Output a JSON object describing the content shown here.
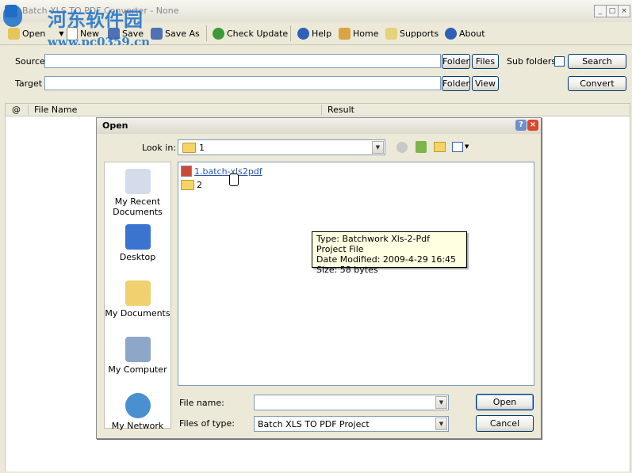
{
  "window": {
    "title": "Batch XLS TO PDF Converter - None",
    "controls": {
      "minimize": "_",
      "maximize": "□",
      "close": "×"
    }
  },
  "watermark": {
    "brand": "河东软件园",
    "url": "www.pc0359.cn"
  },
  "toolbar": {
    "open": "Open",
    "new": "New",
    "save": "Save",
    "save_as": "Save As",
    "check_update": "Check Update",
    "help": "Help",
    "home": "Home",
    "supports": "Supports",
    "about": "About"
  },
  "paths": {
    "source_label": "Source",
    "target_label": "Target",
    "source_value": "",
    "target_value": "",
    "folder": "Folder",
    "files": "Files",
    "view": "View",
    "sub_folders": "Sub folders",
    "search": "Search",
    "convert": "Convert"
  },
  "list": {
    "columns": [
      "@",
      "File Name",
      "Result"
    ]
  },
  "dialog": {
    "title": "Open",
    "help_btn": "?",
    "close_btn": "×",
    "look_in_label": "Look in:",
    "look_in_value": "1",
    "places": [
      "My Recent Documents",
      "Desktop",
      "My Documents",
      "My Computer",
      "My Network"
    ],
    "files": [
      {
        "name": "1.batch-xls2pdf",
        "kind": "project"
      },
      {
        "name": "2",
        "kind": "folder"
      }
    ],
    "tooltip": {
      "type": "Type: Batchwork Xls-2-Pdf Project File",
      "date": "Date Modified: 2009-4-29 16:45",
      "size": "Size: 58 bytes"
    },
    "file_name_label": "File name:",
    "file_name_value": "",
    "file_type_label": "Files of type:",
    "file_type_value": "Batch XLS TO PDF Project",
    "open_button": "Open",
    "cancel_button": "Cancel"
  }
}
